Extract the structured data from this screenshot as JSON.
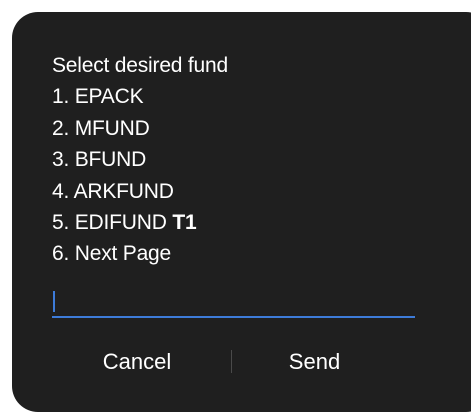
{
  "dialog": {
    "prompt_title": "Select desired fund",
    "options": [
      {
        "label": "1. EPACK"
      },
      {
        "label": "2. MFUND"
      },
      {
        "label": "3. BFUND"
      },
      {
        "label": "4. ARKFUND"
      },
      {
        "label": "5. EDIFUND",
        "badge": "T1"
      },
      {
        "label": "6. Next Page"
      }
    ],
    "input": {
      "value": "",
      "placeholder": ""
    },
    "cancel_label": "Cancel",
    "send_label": "Send"
  },
  "colors": {
    "background": "#1f1f1f",
    "text": "#ffffff",
    "accent": "#3d7bd9",
    "divider": "#4a4a4a"
  }
}
